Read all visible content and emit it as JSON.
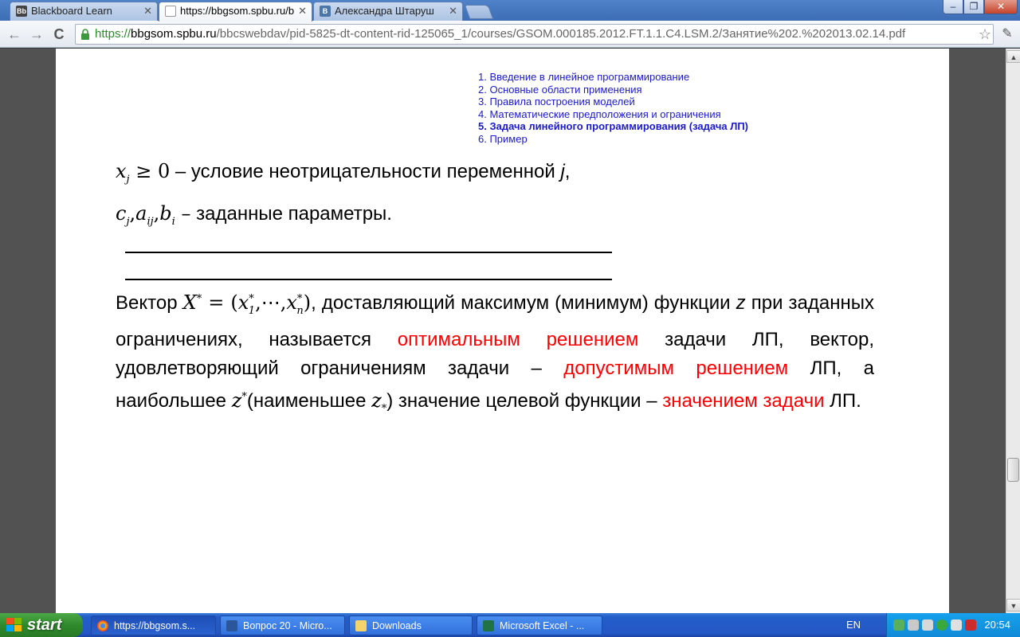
{
  "browser": {
    "tabs": [
      {
        "label": "Blackboard Learn",
        "favicon": "Bb"
      },
      {
        "label": "https://bbgsom.spbu.ru/b",
        "favicon": ""
      },
      {
        "label": "Александра Штаруш",
        "favicon": "В"
      }
    ],
    "window_controls": {
      "minimize": "–",
      "maximize": "❐",
      "close": "✕"
    },
    "nav": {
      "back": "←",
      "forward": "→",
      "reload": "C"
    },
    "url": {
      "scheme": "https://",
      "host": "bbgsom.spbu.ru",
      "path": "/bbcswebdav/pid-5825-dt-content-rid-125065_1/courses/GSOM.000185.2012.FT.1.1.C4.LSM.2/Занятие%202.%202013.02.14.pdf"
    }
  },
  "slide": {
    "toc": [
      "1. Введение в линейное программирование",
      "2. Основные области применения",
      "3. Правила построения моделей",
      "4. Математические предположения и ограничения",
      "5. Задача линейного программирования (задача ЛП)",
      "6. Пример"
    ],
    "line1": {
      "var": "x",
      "sub": "j",
      "op": " ≥ 0",
      "text": " – условие неотрицательности переменной ",
      "jvar": "j",
      "tail": ","
    },
    "line2": {
      "c": "c",
      "c_sub": "j",
      "a": "a",
      "a_sub": "ij",
      "b": "b",
      "b_sub": "i",
      "dash": " –",
      "text": " заданные параметры."
    },
    "paragraph": {
      "p1": "Вектор ",
      "m_X": "X",
      "m_star": "*",
      "m_eq": " = (",
      "m_x1": "x",
      "m_x1_sup": "*",
      "m_x1_sub": "1",
      "m_dots": ",⋯,",
      "m_xn": "x",
      "m_xn_sup": "*",
      "m_xn_sub": "n",
      "m_close": ")",
      "p2": ", доставляющий максимум (минимум) функции ",
      "z_var": "z",
      "p3": " при заданных ограничениях, называется ",
      "red1": "оптимальным решением",
      "p4": " задачи ЛП, вектор, удовлетворяющий ограничениям задачи – ",
      "red2": "допустимым решением",
      "p5": " ЛП, а наибольшее ",
      "m_zs": "z",
      "m_zs_sup": "*",
      "p6": "(наименьшее ",
      "m_zsub": "z",
      "m_zsub_sub": "*",
      "p7": ") значение целевой функции – ",
      "red3": "значением задачи",
      "p8": " ЛП."
    }
  },
  "scrollbar": {
    "up": "▲",
    "down": "▼"
  },
  "taskbar": {
    "start": "start",
    "tasks": [
      "https://bbgsom.s...",
      "Вопрос 20 - Micro...",
      "Downloads",
      "Microsoft Excel - ..."
    ],
    "lang": "EN",
    "clock": "20:54"
  }
}
